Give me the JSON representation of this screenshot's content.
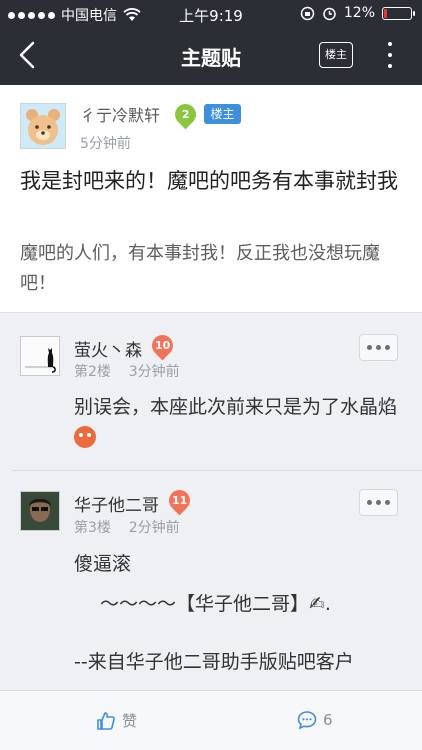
{
  "status_bar": {
    "carrier": "中国电信",
    "time": "上午9:19",
    "battery_percent_label": "12%",
    "battery_level": 0.12
  },
  "nav": {
    "title": "主题贴",
    "louzhu_button": "楼主"
  },
  "main_post": {
    "author": "彳亍冷默轩",
    "level": "2",
    "level_color": "#8cc63f",
    "louzhu_tag": "楼主",
    "time": "5分钟前",
    "title": "我是封吧来的！魔吧的吧务有本事就封我",
    "body": "魔吧的人们，有本事封我！反正我也没想玩魔吧！"
  },
  "replies": [
    {
      "author": "萤火丶森",
      "level": "10",
      "level_color": "#f0735a",
      "floor": "第2楼",
      "time": "3分钟前",
      "content": "别误会，本座此次前来只是为了水晶焰"
    },
    {
      "author": "华子他二哥",
      "level": "11",
      "level_color": "#f0735a",
      "floor": "第3楼",
      "time": "2分钟前",
      "content_line1": "傻逼滚",
      "content_line2": "～～～～【华子他二哥】✍.",
      "content_line3": "--来自华子他二哥助手版贴吧客户"
    }
  ],
  "bottom_bar": {
    "like_label": "赞",
    "comment_count": "6"
  },
  "colors": {
    "header_bg": "#2b2e35",
    "accent_blue": "#3e8fde",
    "page_bg": "#eef0f3"
  }
}
